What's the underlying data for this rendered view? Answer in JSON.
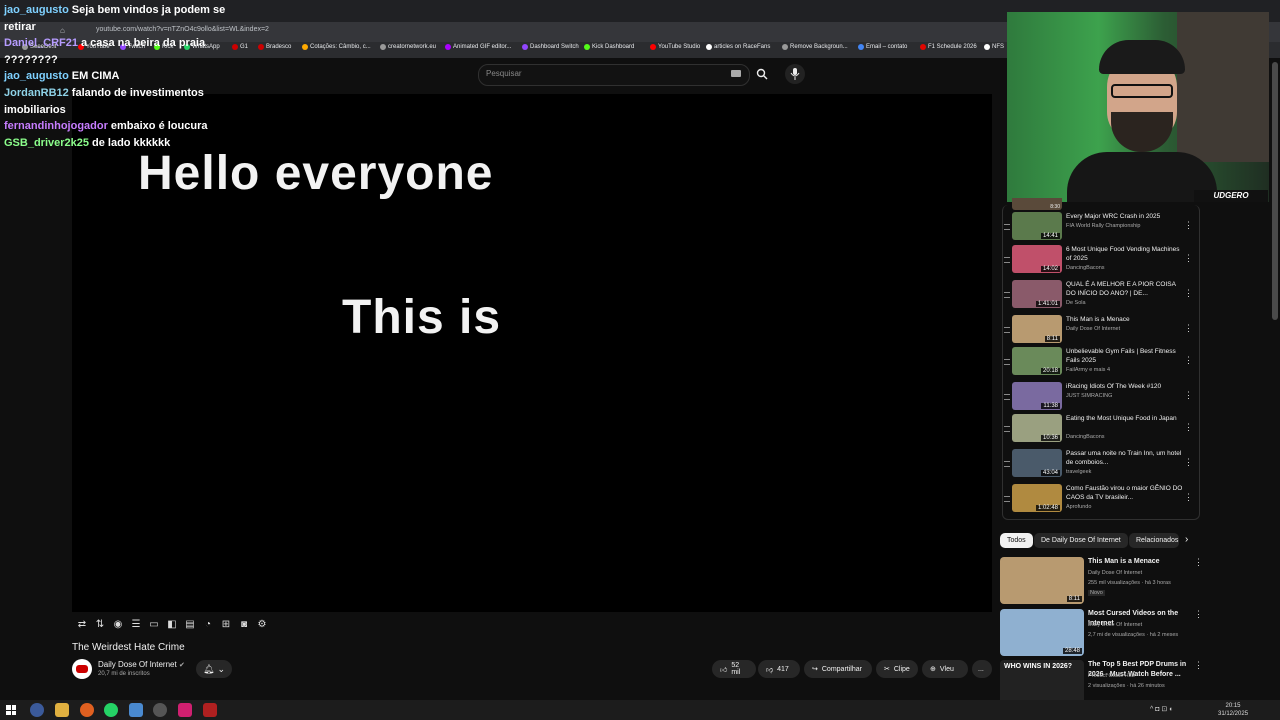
{
  "browser": {
    "url": "youtube.com/watch?v=nTZnO4c9ollo&list=WL&index=2",
    "bookmarks": [
      "SeeeDe.it",
      "YouTube",
      "Twitch",
      "Kick",
      "WhatsApp",
      "G1",
      "Bradesco",
      "Cotações: Câmbio, c...",
      "creatornetwork.eu",
      "Animated GIF editor...",
      "Dashboard Switch",
      "Kick Dashboard",
      "YouTube Studio",
      "articles on RaceFans",
      "Remove Backgroun...",
      "Email – contato",
      "F1 Schedule 2026",
      "NFS"
    ]
  },
  "search": {
    "placeholder": "Pesquisar"
  },
  "video": {
    "caption_line1": "Hello everyone",
    "caption_line2": "This is",
    "title": "The Weirdest Hate Crime",
    "channel": "Daily Dose Of Internet",
    "subscribers": "20,7 mi de inscritos",
    "likes": "52 mil",
    "dislikes": "417",
    "share": "Compartilhar",
    "clip": "Clipe",
    "save": "Salvar",
    "save_display": "Vleu",
    "more": "..."
  },
  "chat": [
    {
      "user": "jao_augusto",
      "color": "#7fd1ff",
      "text": "Seja bem vindos ja podem se retirar"
    },
    {
      "user": "Daniel_CRF21",
      "color": "#b69cff",
      "text": "a casa na beira da praia ????????"
    },
    {
      "user": "jao_augusto",
      "color": "#7fd1ff",
      "text": "EM CIMA"
    },
    {
      "user": "JordanRB12",
      "color": "#8fd3e8",
      "text": "falando de investimentos imobiliarios"
    },
    {
      "user": "fernandinhojogador",
      "color": "#c77dff",
      "text": "embaixo é loucura"
    },
    {
      "user": "GSB_driver2k25",
      "color": "#8cff8c",
      "text": "de lado kkkkkk"
    }
  ],
  "webcam": {
    "logo": "UDGERO"
  },
  "playlist": [
    {
      "title": "Every Major WRC Crash in 2025",
      "channel": "FIA World Rally Championship",
      "duration": "14:41",
      "color": "#5b7a4c"
    },
    {
      "title": "6 Most Unique Food Vending Machines of 2025",
      "channel": "DancingBacons",
      "duration": "14:02",
      "color": "#c0506a"
    },
    {
      "title": "QUAL É A MELHOR E A PIOR COISA DO INÍCIO DO ANO? | DE...",
      "channel": "De Sola",
      "duration": "1:41:01",
      "color": "#8a5a6a"
    },
    {
      "title": "This Man is a Menace",
      "channel": "Daily Dose Of Internet",
      "duration": "8:11",
      "color": "#b89a70"
    },
    {
      "title": "Unbelievable Gym Fails | Best Fitness Fails 2025",
      "channel": "FailArmy e mais 4",
      "duration": "20:18",
      "color": "#6a8a5a"
    },
    {
      "title": "iRacing Idiots Of The Week #120",
      "channel": "JUST SIMRACING",
      "duration": "11:38",
      "color": "#7a6aa0"
    },
    {
      "title": "Eating the Most Unique Food in Japan",
      "channel": "DancingBacons",
      "duration": "10:36",
      "color": "#9aa080"
    },
    {
      "title": "Passar uma noite no Train Inn, um hotel de comboios...",
      "channel": "travelgeek",
      "duration": "43:04",
      "color": "#4a5a6a"
    },
    {
      "title": "Como Faustão virou o maior GÊNIO DO CAOS da TV brasileir...",
      "channel": "Aprofundo",
      "duration": "1:02:48",
      "color": "#b08a40"
    }
  ],
  "playlist_prev_duration": "8:30",
  "chips": [
    "Todos",
    "De Daily Dose Of Internet",
    "Relacionados"
  ],
  "recommendations": [
    {
      "title": "This Man is a Menace",
      "channel": "Daily Dose Of Internet",
      "meta": "255 mil visualizações · há 3 horas",
      "badge": "Novo",
      "duration": "8:11",
      "color": "#b89a70"
    },
    {
      "title": "Most Cursed Videos on the Internet",
      "channel": "Daily Dose Of Internet",
      "meta": "2,7 mi de visualizações · há 2 meses",
      "badge": "",
      "duration": "28:48",
      "color": "#8fb0d0"
    },
    {
      "title": "The Top 5 Best PDP Drums in 2026 - Must Watch Before ...",
      "channel": "Product Guide Hub",
      "meta": "2 visualizações · há 26 minutos",
      "badge": "",
      "duration": "",
      "thumb_text": "WHO WINS IN 2026?",
      "color": "#222222"
    }
  ],
  "clock": {
    "time": "20:15",
    "date": "31/12/2025"
  }
}
